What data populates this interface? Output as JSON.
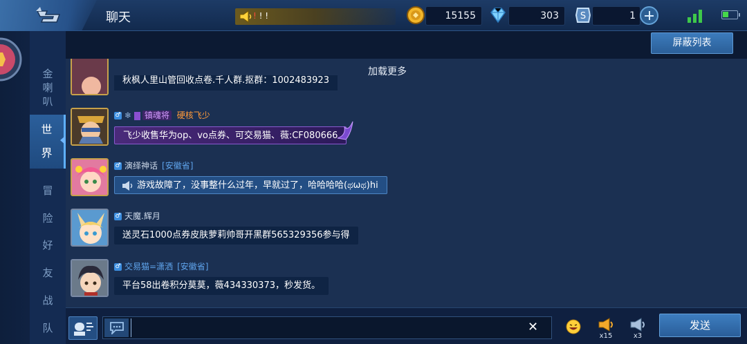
{
  "header": {
    "title": "聊天",
    "announcement_red": "!",
    "announcement_rest": " ! !",
    "gold": "15155",
    "diamonds": "303",
    "coupons": "1"
  },
  "buttons": {
    "block_list": "屏蔽列表",
    "send": "发送",
    "clear": "✕"
  },
  "tabs": [
    {
      "label": "金\n喇\n叭"
    },
    {
      "label": "世\n界"
    },
    {
      "label": "冒\n险"
    },
    {
      "label": "好\n友"
    },
    {
      "label": "战\n队"
    }
  ],
  "chat": {
    "load_more": "加载更多",
    "truncated_text": "秋枫人里山管回收点卷.千人群.抠群：1002483923",
    "messages": [
      {
        "badges": "♂ ❄ ▮",
        "title_tag": "镇魂将",
        "name": "硬核飞少",
        "region": "",
        "text": "飞少收售华为op、vo点券、可交易猫、薇:CF080666"
      },
      {
        "badges": "♂",
        "name": "演绎神话",
        "region": "[安徽省]",
        "text": "游戏故障了，没事整什么过年，早就过了，哈哈哈哈(ಥωಥ)hi"
      },
      {
        "badges": "♂",
        "name": "天魔.辉月",
        "region": "",
        "text": "送灵石1000点券皮肤萝莉帅哥开黑群565329356参与得"
      },
      {
        "badges": "♂",
        "name": "交易猫=潇洒",
        "region": "[安徽省]",
        "text": "平台58出卷积分莫莫，薇434330373，秒发货。"
      }
    ]
  },
  "horns": [
    {
      "count": "x15"
    },
    {
      "count": "x3"
    }
  ],
  "input": {
    "placeholder": ""
  },
  "colors": {
    "accent": "#3d7dc0",
    "region": "#5fa4ec",
    "purple_bubble": "#4a2a7a",
    "gold_border": "#c8a24a"
  }
}
